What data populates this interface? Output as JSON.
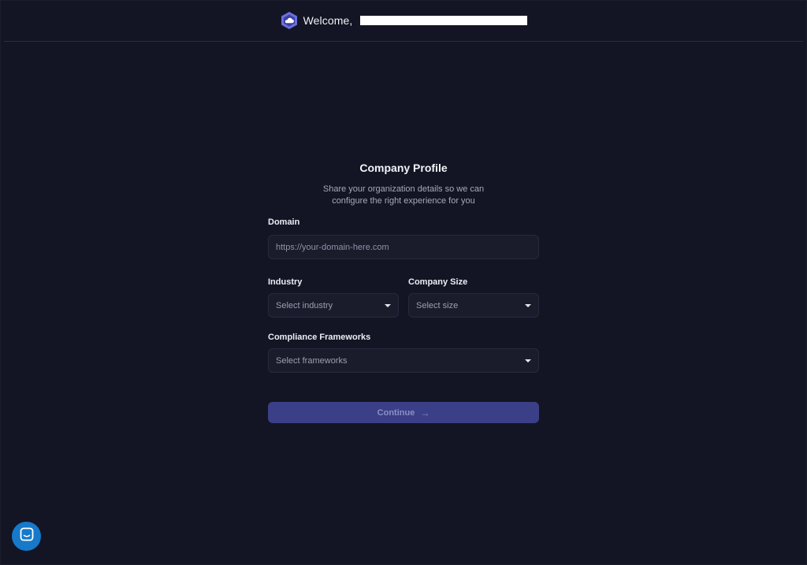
{
  "header": {
    "logo_icon": "hexagon-cloud-logo-icon",
    "welcome_text": "Welcome,"
  },
  "form": {
    "title": "Company Profile",
    "subtitle_line1": "Share your organization details so we can",
    "subtitle_line2": "configure the right experience for you",
    "domain": {
      "label": "Domain",
      "placeholder": "https://your-domain-here.com",
      "value": ""
    },
    "industry": {
      "label": "Industry",
      "selected": "Select industry"
    },
    "company_size": {
      "label": "Company Size",
      "selected": "Select size"
    },
    "compliance": {
      "label": "Compliance Frameworks",
      "selected": "Select frameworks"
    },
    "continue_label": "Continue",
    "continue_icon": "arrow-right-icon"
  },
  "chat_widget": {
    "icon": "chat-bubble-icon"
  },
  "colors": {
    "background": "#131524",
    "accent": "#3a3f87",
    "chat": "#1779c9",
    "logo": "#6a6fe0"
  }
}
